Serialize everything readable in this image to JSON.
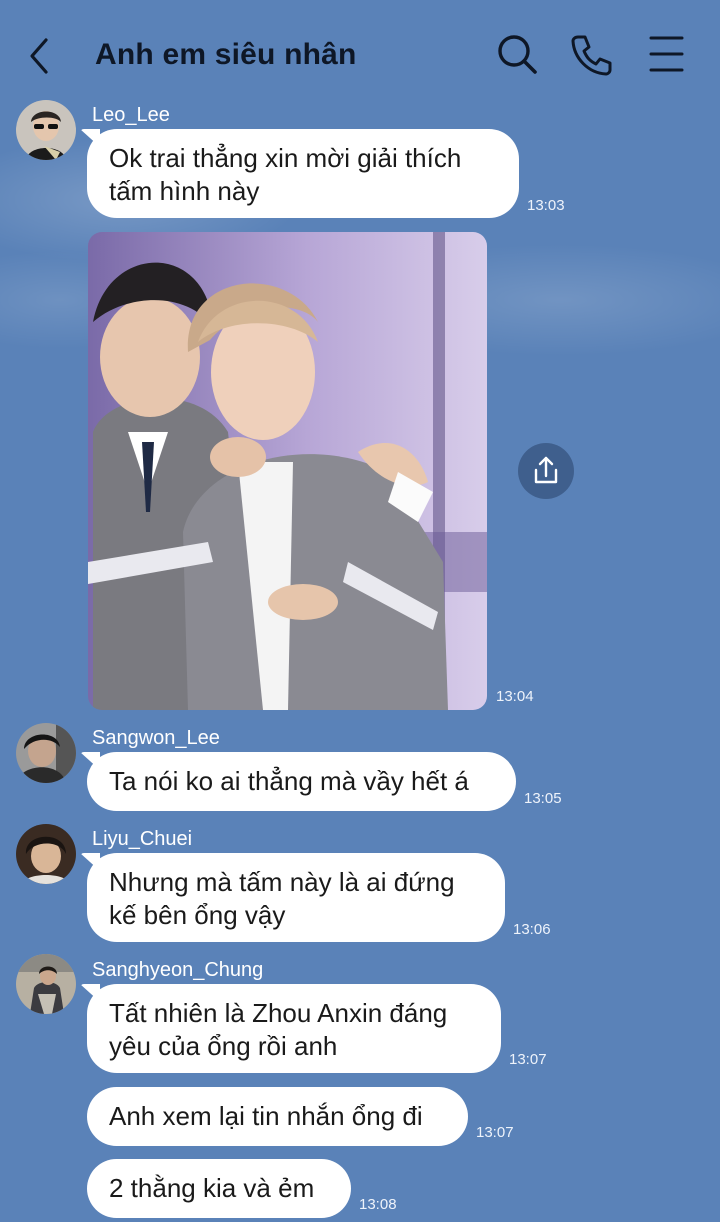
{
  "chat": {
    "title": "Anh em siêu nhân",
    "icons": [
      "chevron-left-icon",
      "search-icon",
      "phone-icon",
      "menu-icon"
    ]
  },
  "messages": [
    {
      "sender": "Leo_Lee",
      "text": [
        "Ok trai thẳng xin mời giải thích",
        "tấm hình này"
      ],
      "time": "13:03"
    },
    {
      "sender": "Leo_Lee",
      "type": "photo",
      "time": "13:04"
    },
    {
      "sender": "Sangwon_Lee",
      "text": [
        "Ta nói ko ai thẳng mà vầy hết á"
      ],
      "time": "13:05"
    },
    {
      "sender": "Liyu_Chuei",
      "text": [
        "Nhưng mà tấm này là ai đứng",
        "kế bên ổng vậy"
      ],
      "time": "13:06"
    },
    {
      "sender": "Sanghyeon_Chung",
      "text": [
        "Tất nhiên là Zhou Anxin đáng",
        "yêu của ổng rồi anh"
      ],
      "time": "13:07"
    },
    {
      "sender": "Sanghyeon_Chung",
      "text": [
        "Anh xem lại tin nhắn ổng đi"
      ],
      "time": "13:07"
    },
    {
      "sender": "Sanghyeon_Chung",
      "text": [
        "2 thằng kia và ẻm"
      ],
      "time": "13:08"
    }
  ],
  "colors": {
    "background": "#5a82b8",
    "bubble": "#ffffff",
    "title": "#0e1726"
  }
}
